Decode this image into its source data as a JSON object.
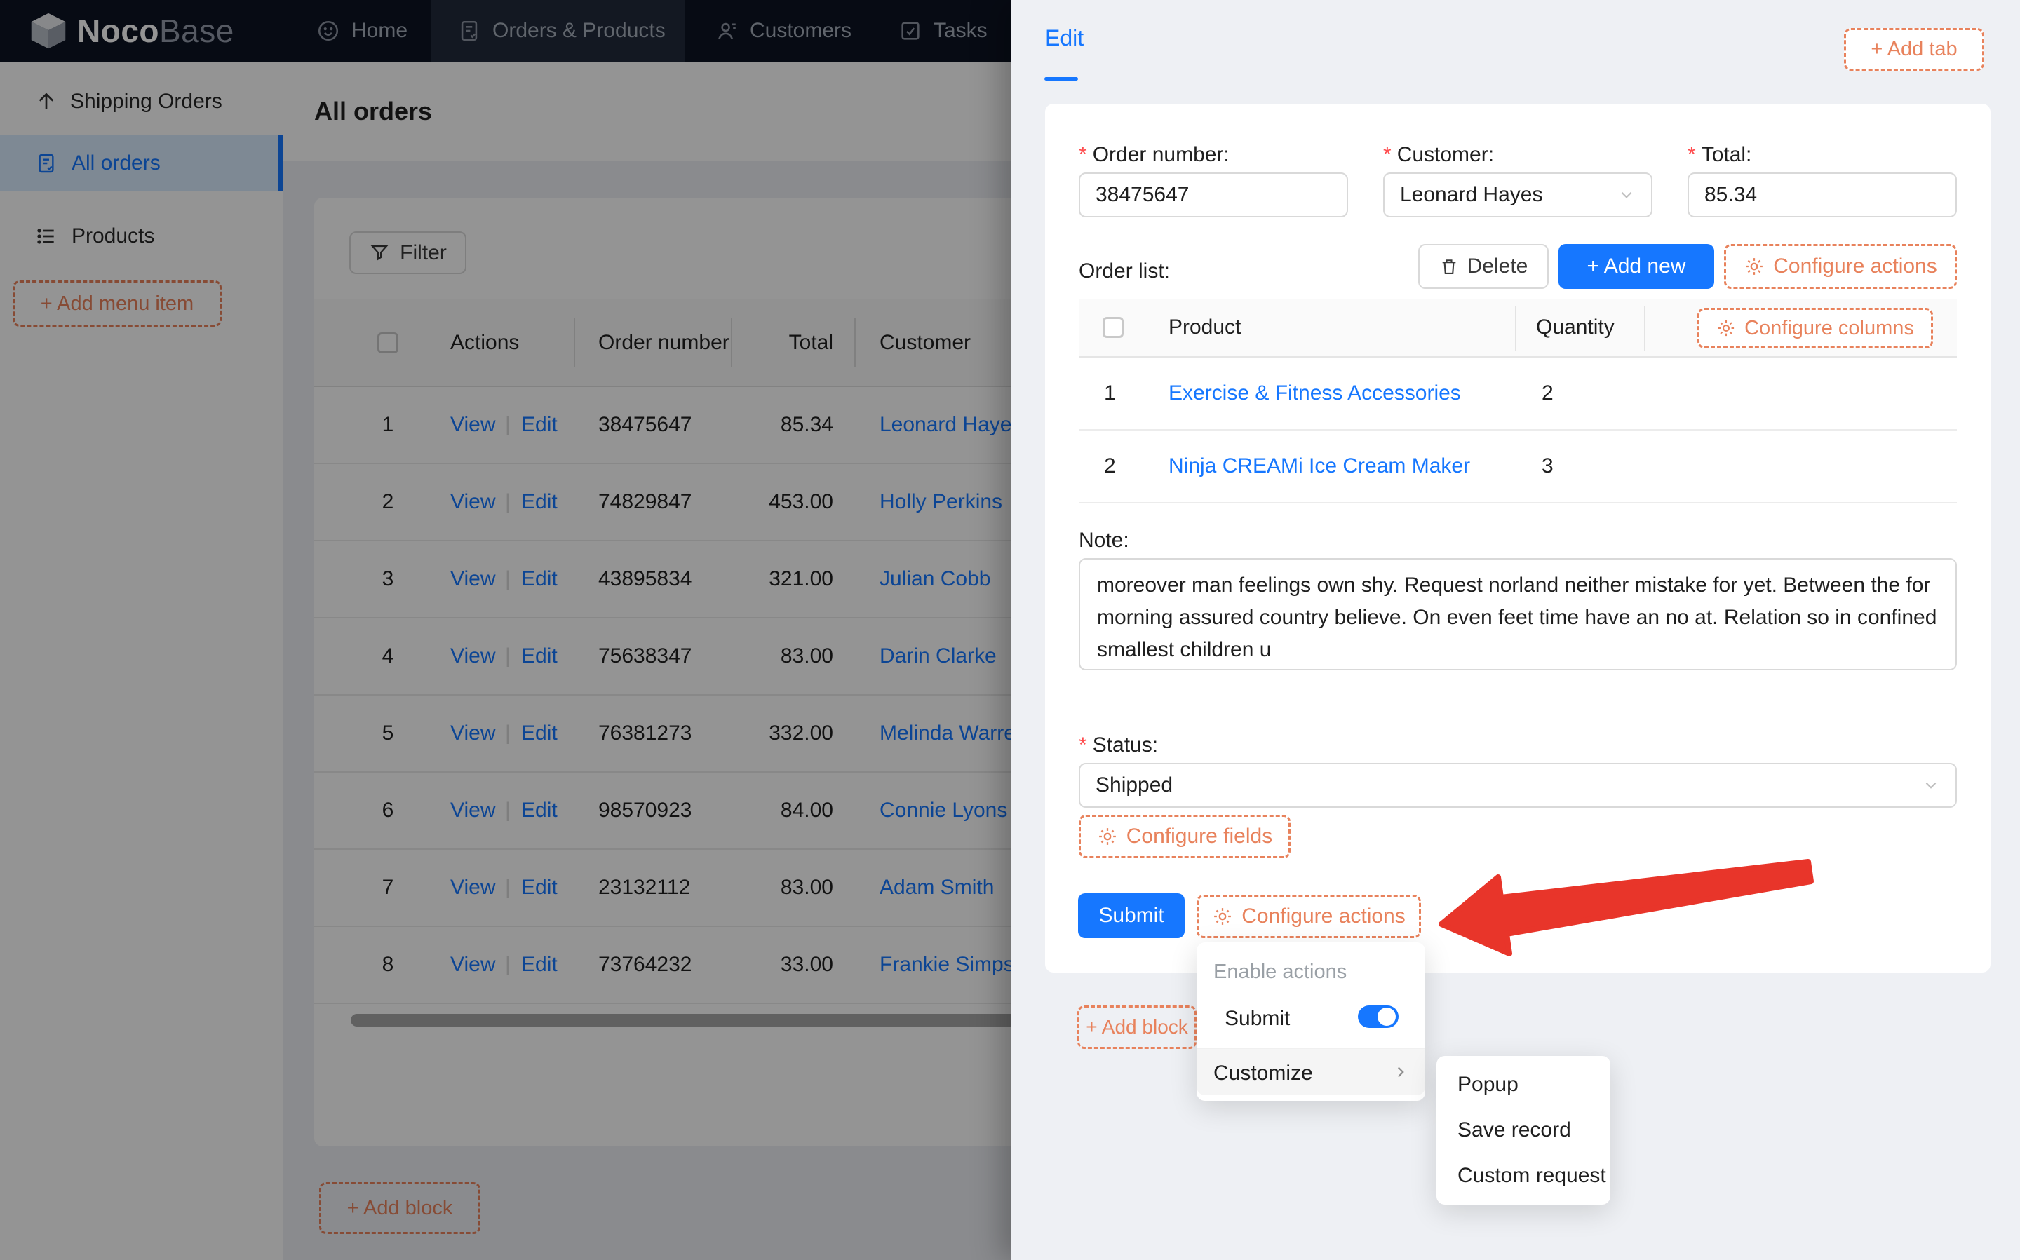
{
  "navbar": {
    "brand_bold": "Noco",
    "brand_light": "Base",
    "items": [
      {
        "label": "Home"
      },
      {
        "label": "Orders & Products"
      },
      {
        "label": "Customers"
      },
      {
        "label": "Tasks"
      }
    ]
  },
  "sidebar": {
    "group_label": "Shipping Orders",
    "item_all_orders": "All orders",
    "item_products": "Products",
    "add_menu_label": "+ Add menu item"
  },
  "main": {
    "title": "All orders",
    "filter_label": "Filter",
    "table": {
      "columns": {
        "actions": "Actions",
        "order_number": "Order number",
        "total": "Total",
        "customer": "Customer"
      },
      "actions": {
        "view": "View",
        "edit": "Edit"
      },
      "rows": [
        {
          "index": "1",
          "order_number": "38475647",
          "total": "85.34",
          "customer": "Leonard Hayes"
        },
        {
          "index": "2",
          "order_number": "74829847",
          "total": "453.00",
          "customer": "Holly Perkins"
        },
        {
          "index": "3",
          "order_number": "43895834",
          "total": "321.00",
          "customer": "Julian Cobb"
        },
        {
          "index": "4",
          "order_number": "75638347",
          "total": "83.00",
          "customer": "Darin Clarke"
        },
        {
          "index": "5",
          "order_number": "76381273",
          "total": "332.00",
          "customer": "Melinda Warren"
        },
        {
          "index": "6",
          "order_number": "98570923",
          "total": "84.00",
          "customer": "Connie Lyons"
        },
        {
          "index": "7",
          "order_number": "23132112",
          "total": "83.00",
          "customer": "Adam Smith"
        },
        {
          "index": "8",
          "order_number": "73764232",
          "total": "33.00",
          "customer": "Frankie Simpson"
        }
      ]
    },
    "add_block_label": "+ Add block"
  },
  "drawer": {
    "tab_label": "Edit",
    "add_tab_label": "+ Add tab",
    "form": {
      "order_number": {
        "label": "Order number:",
        "value": "38475647"
      },
      "customer": {
        "label": "Customer:",
        "value": "Leonard Hayes"
      },
      "total": {
        "label": "Total:",
        "value": "85.34"
      },
      "order_list": {
        "label": "Order list:",
        "delete_label": "Delete",
        "add_new_label": "+ Add new",
        "configure_actions_label": "Configure actions",
        "table": {
          "col_product": "Product",
          "col_quantity": "Quantity",
          "configure_columns_label": "Configure columns",
          "rows": [
            {
              "index": "1",
              "product": "Exercise & Fitness Accessories",
              "quantity": "2"
            },
            {
              "index": "2",
              "product": "Ninja CREAMi Ice Cream Maker",
              "quantity": "3"
            }
          ]
        }
      },
      "note": {
        "label": "Note:",
        "value": "moreover man feelings own shy. Request norland neither mistake for yet. Between the for morning assured country believe. On even feet time have an no at. Relation so in confined smallest children u"
      },
      "status": {
        "label": "Status:",
        "value": "Shipped"
      }
    },
    "configure_fields_label": "Configure fields",
    "submit_label": "Submit",
    "configure_actions_label": "Configure actions",
    "add_block_label": "+ Add block",
    "actions_menu": {
      "group_label": "Enable actions",
      "submit_label": "Submit",
      "submit_toggle_on": true,
      "customize_label": "Customize",
      "submenu": [
        {
          "label": "Popup"
        },
        {
          "label": "Save record"
        },
        {
          "label": "Custom request"
        }
      ]
    }
  },
  "colors": {
    "primary": "#1677ff",
    "designer_orange": "#e8825c",
    "danger_asterisk": "#ff4d4f",
    "arrow_red": "#e8352a",
    "navbar_bg": "#0d1424"
  }
}
